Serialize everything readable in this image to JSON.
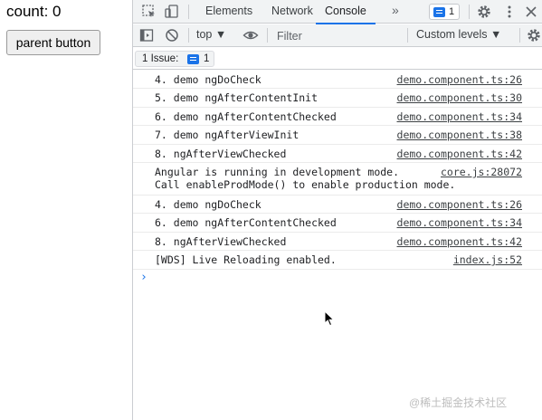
{
  "app": {
    "count_text": "count: 0",
    "parent_button_label": "parent button"
  },
  "devtools": {
    "tabs": [
      {
        "label": "Elements",
        "active": false
      },
      {
        "label": "Network",
        "active": false
      },
      {
        "label": "Console",
        "active": true
      }
    ],
    "more_tabs_glyph": "»",
    "issues_count": "1",
    "toolbar": {
      "context_value": "top ▼",
      "filter_placeholder": "Filter",
      "levels_label": "Custom levels ▼"
    },
    "issue_bar": {
      "label": "1 Issue:",
      "count": "1"
    },
    "prompt_glyph": "›",
    "console_rows": [
      {
        "lines": [
          "4. demo ngDoCheck"
        ],
        "source": "demo.component.ts:26"
      },
      {
        "lines": [
          "5. demo ngAfterContentInit"
        ],
        "source": "demo.component.ts:30"
      },
      {
        "lines": [
          "6. demo ngAfterContentChecked"
        ],
        "source": "demo.component.ts:34"
      },
      {
        "lines": [
          "7. demo ngAfterViewInit"
        ],
        "source": "demo.component.ts:38"
      },
      {
        "lines": [
          "8. ngAfterViewChecked"
        ],
        "source": "demo.component.ts:42"
      },
      {
        "lines": [
          "Angular is running in development mode.",
          "Call enableProdMode() to enable production mode."
        ],
        "source": "core.js:28072"
      },
      {
        "lines": [
          "4. demo ngDoCheck"
        ],
        "source": "demo.component.ts:26"
      },
      {
        "lines": [
          "6. demo ngAfterContentChecked"
        ],
        "source": "demo.component.ts:34"
      },
      {
        "lines": [
          "8. ngAfterViewChecked"
        ],
        "source": "demo.component.ts:42"
      },
      {
        "lines": [
          "[WDS] Live Reloading enabled."
        ],
        "source": "index.js:52"
      }
    ]
  },
  "watermark": "@稀土掘金技术社区",
  "colors": {
    "accent": "#1a73e8",
    "toolbar_bg": "#f1f3f4",
    "border": "#cbcdd1"
  }
}
